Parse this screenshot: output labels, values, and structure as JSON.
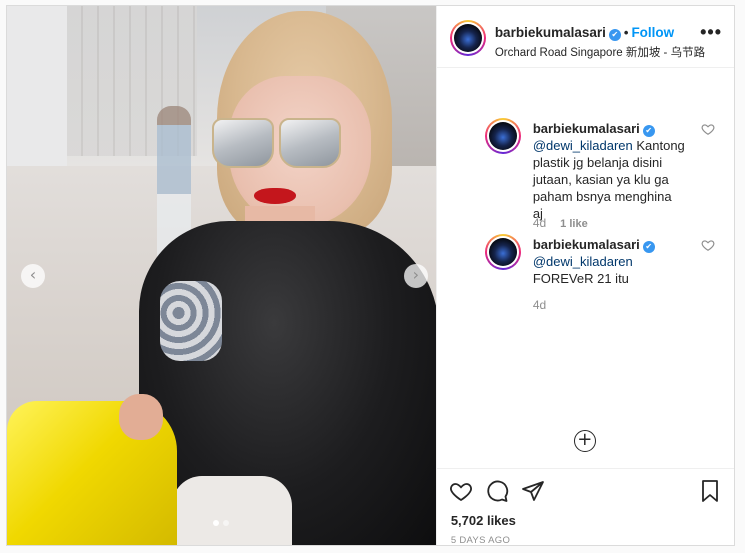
{
  "post": {
    "photo": {
      "nav_prev": "‹",
      "nav_next": "›",
      "slide_count": 2,
      "active_slide": 1
    },
    "header": {
      "username": "barbiekumalasari",
      "verified_icon": "✔",
      "separator": "•",
      "follow_label": "Follow",
      "location": "Orchard Road Singapore 新加坡 - 乌节路",
      "more_label": "•••"
    },
    "comments": [
      {
        "username": "barbiekumalasari",
        "mention": "@dewi_kiladaren",
        "text": "Kantong plastik jg belanja disini jutaan, kasian ya klu ga paham bsnya menghina aj",
        "age": "4d",
        "likes": "1 like"
      },
      {
        "username": "barbiekumalasari",
        "mention": "@dewi_kiladaren",
        "text": "FOREVeR 21 itu",
        "age": "4d",
        "likes": ""
      }
    ],
    "load_more_icon": "+",
    "actions": {
      "likes": "5,702 likes",
      "timestamp": "5 DAYS AGO"
    }
  },
  "colors": {
    "accent": "#0095f6",
    "verified": "#3897f0",
    "muted": "#8e8e8e",
    "text": "#262626"
  }
}
